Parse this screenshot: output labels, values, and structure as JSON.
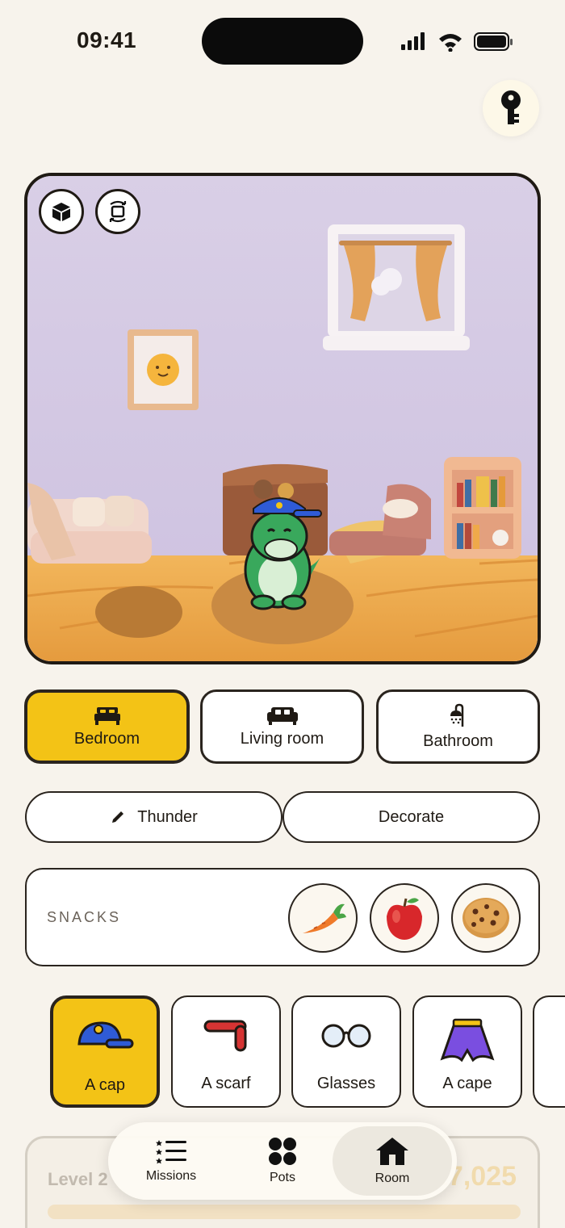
{
  "status_bar": {
    "time": "09:41"
  },
  "header": {
    "key_button_icon": "key-icon"
  },
  "room_view": {
    "buttons": [
      {
        "icon": "box-3d-icon"
      },
      {
        "icon": "rotate-icon"
      }
    ]
  },
  "rooms": [
    {
      "label": "Bedroom",
      "icon": "bed-icon",
      "selected": true
    },
    {
      "label": "Living room",
      "icon": "sofa-icon",
      "selected": false
    },
    {
      "label": "Bathroom",
      "icon": "shower-icon",
      "selected": false
    }
  ],
  "actions": {
    "rename_label": "Thunder",
    "rename_icon": "pencil-icon",
    "decorate_label": "Decorate"
  },
  "snacks": {
    "label": "SNACKS",
    "items": [
      {
        "icon": "carrot-icon"
      },
      {
        "icon": "apple-icon"
      },
      {
        "icon": "cookie-icon"
      }
    ]
  },
  "accessories": [
    {
      "label": "A cap",
      "icon": "cap-icon",
      "selected": true
    },
    {
      "label": "A scarf",
      "icon": "scarf-icon",
      "selected": false
    },
    {
      "label": "Glasses",
      "icon": "glasses-icon",
      "selected": false
    },
    {
      "label": "A cape",
      "icon": "cape-icon",
      "selected": false
    }
  ],
  "level": {
    "label": "Level 2",
    "coins": "17,025",
    "progress": 0
  },
  "tab_bar": {
    "items": [
      {
        "label": "Missions",
        "icon": "list-icon",
        "active": false
      },
      {
        "label": "Pots",
        "icon": "grid-dots-icon",
        "active": false
      },
      {
        "label": "Room",
        "icon": "home-icon",
        "active": true
      }
    ]
  }
}
